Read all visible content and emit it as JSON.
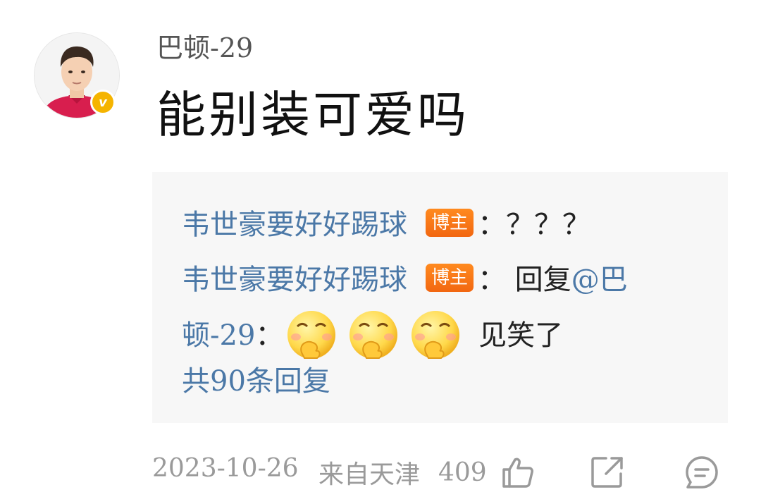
{
  "comment": {
    "username": "巴顿-29",
    "text": "能别装可爱吗",
    "verified": true
  },
  "replies": {
    "reply1": {
      "author": "韦世豪要好好踢球",
      "tag": "博主",
      "colon": "：",
      "text": "？？？"
    },
    "reply2": {
      "author": "韦世豪要好好踢球",
      "tag": "博主",
      "colon": "：",
      "prefix": "回复",
      "mention_line1": "@巴",
      "mention_line2": "顿-29",
      "colon2": "：",
      "emoji": "giggle-emoji",
      "text": "见笑了"
    },
    "count_label": "共90条回复"
  },
  "footer": {
    "date": "2023-10-26",
    "location": "来自天津",
    "like_count": "409"
  },
  "colors": {
    "link": "#4b78a7",
    "tag": "#f26711",
    "badge": "#f5b400",
    "reply_bg": "#f7f7f7",
    "meta": "#9a9a9a"
  },
  "icons": {
    "like": "thumbs-up-icon",
    "share": "share-icon",
    "comment": "comment-icon",
    "verified": "verified-badge-icon"
  }
}
